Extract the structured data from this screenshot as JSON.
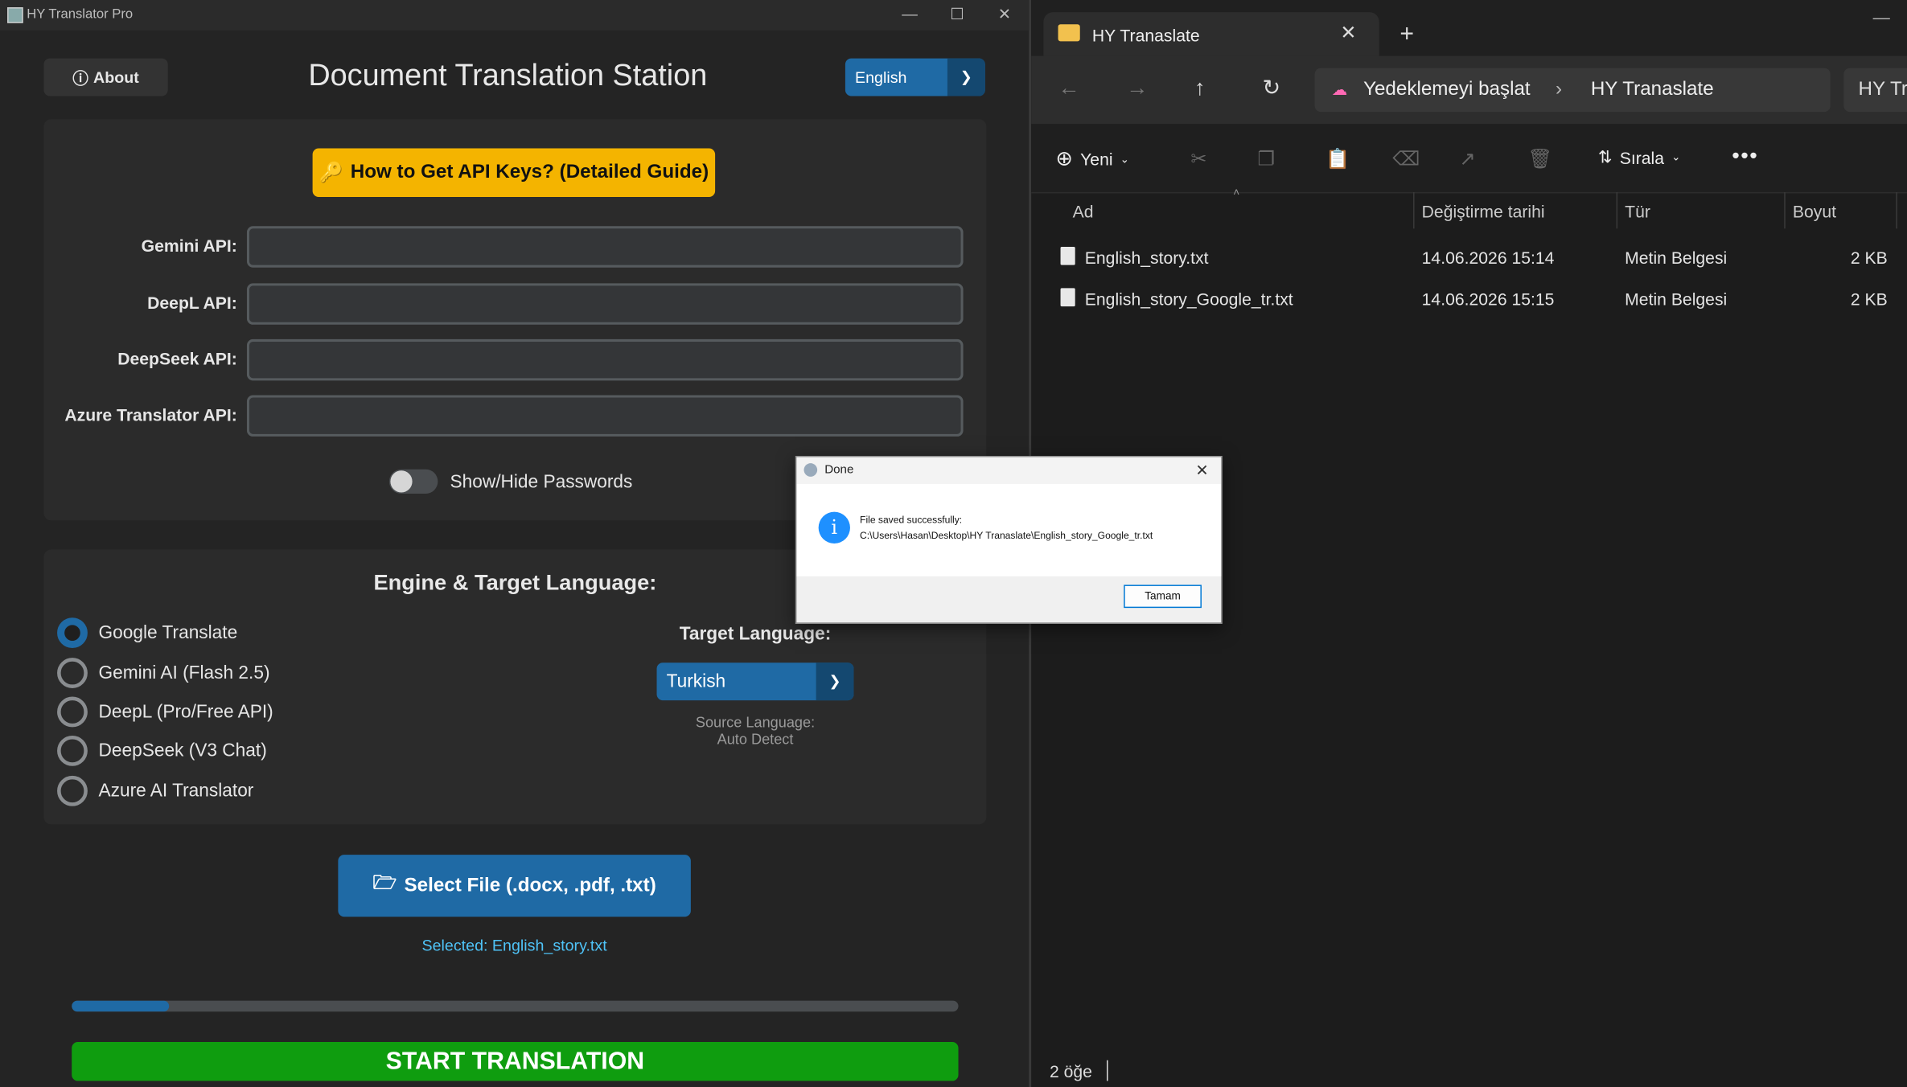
{
  "app": {
    "window_title": "HY Translator Pro",
    "about_label": "About",
    "main_title": "Document Translation Station",
    "ui_language": "English",
    "guide_button": "How to Get API Keys? (Detailed Guide)",
    "api_fields": [
      {
        "label": "Gemini API:",
        "value": ""
      },
      {
        "label": "DeepL API:",
        "value": ""
      },
      {
        "label": "DeepSeek API:",
        "value": ""
      },
      {
        "label": "Azure Translator API:",
        "value": ""
      }
    ],
    "toggle_label": "Show/Hide Passwords",
    "toggle_on": false,
    "engine_title": "Engine & Target Language:",
    "engines": [
      {
        "label": "Google Translate",
        "selected": true
      },
      {
        "label": "Gemini AI (Flash 2.5)",
        "selected": false
      },
      {
        "label": "DeepL (Pro/Free API)",
        "selected": false
      },
      {
        "label": "DeepSeek (V3 Chat)",
        "selected": false
      },
      {
        "label": "Azure AI Translator",
        "selected": false
      }
    ],
    "target_label": "Target Language:",
    "target_value": "Turkish",
    "source_label": "Source Language:",
    "source_value": "Auto Detect",
    "select_file_button": "Select File (.docx, .pdf, .txt)",
    "selected_file": "Selected: English_story.txt",
    "progress": 0.11,
    "start_button": "START TRANSLATION",
    "colors": {
      "accent": "#1f6aa5",
      "guide": "#f4b400",
      "start": "#0f9d0f",
      "selected_text": "#4fc3f7"
    }
  },
  "explorer": {
    "tab_title": "HY Tranaslate",
    "breadcrumb": [
      "Yedeklemeyi başlat",
      "HY Tranaslate"
    ],
    "search_text": "HY Tra",
    "new_label": "Yeni",
    "sort_label": "Sırala",
    "columns": [
      "Ad",
      "Değiştirme tarihi",
      "Tür",
      "Boyut"
    ],
    "files": [
      {
        "name": "English_story.txt",
        "modified": "14.06.2026 15:14",
        "type": "Metin Belgesi",
        "size": "2 KB"
      },
      {
        "name": "English_story_Google_tr.txt",
        "modified": "14.06.2026 15:15",
        "type": "Metin Belgesi",
        "size": "2 KB"
      }
    ],
    "status": "2 öğe"
  },
  "dialog": {
    "title": "Done",
    "message_line1": "File saved successfully:",
    "message_line2": "C:\\Users\\Hasan\\Desktop\\HY Tranaslate\\English_story_Google_tr.txt",
    "ok_label": "Tamam"
  }
}
